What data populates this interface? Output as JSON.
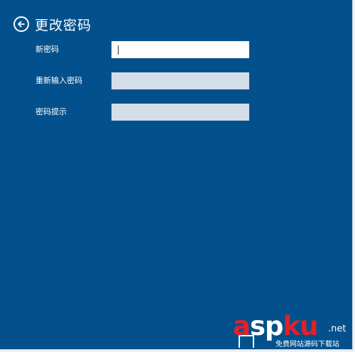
{
  "header": {
    "title": "更改密码",
    "back_icon": "back-arrow-circle-icon"
  },
  "form": {
    "fields": [
      {
        "label": "新密码",
        "value": ""
      },
      {
        "label": "重新输入密码",
        "value": ""
      },
      {
        "label": "密码提示",
        "value": ""
      }
    ]
  },
  "watermark": {
    "brand_a": "a",
    "brand_sp": "sp",
    "brand_ku": "ku",
    "tld": ".net",
    "subtitle": "免费网站源码下载站"
  },
  "colors": {
    "background": "#03518c",
    "active_field": "#ffffff",
    "inactive_field": "#d3dee9",
    "watermark_red": "#e2202a"
  }
}
